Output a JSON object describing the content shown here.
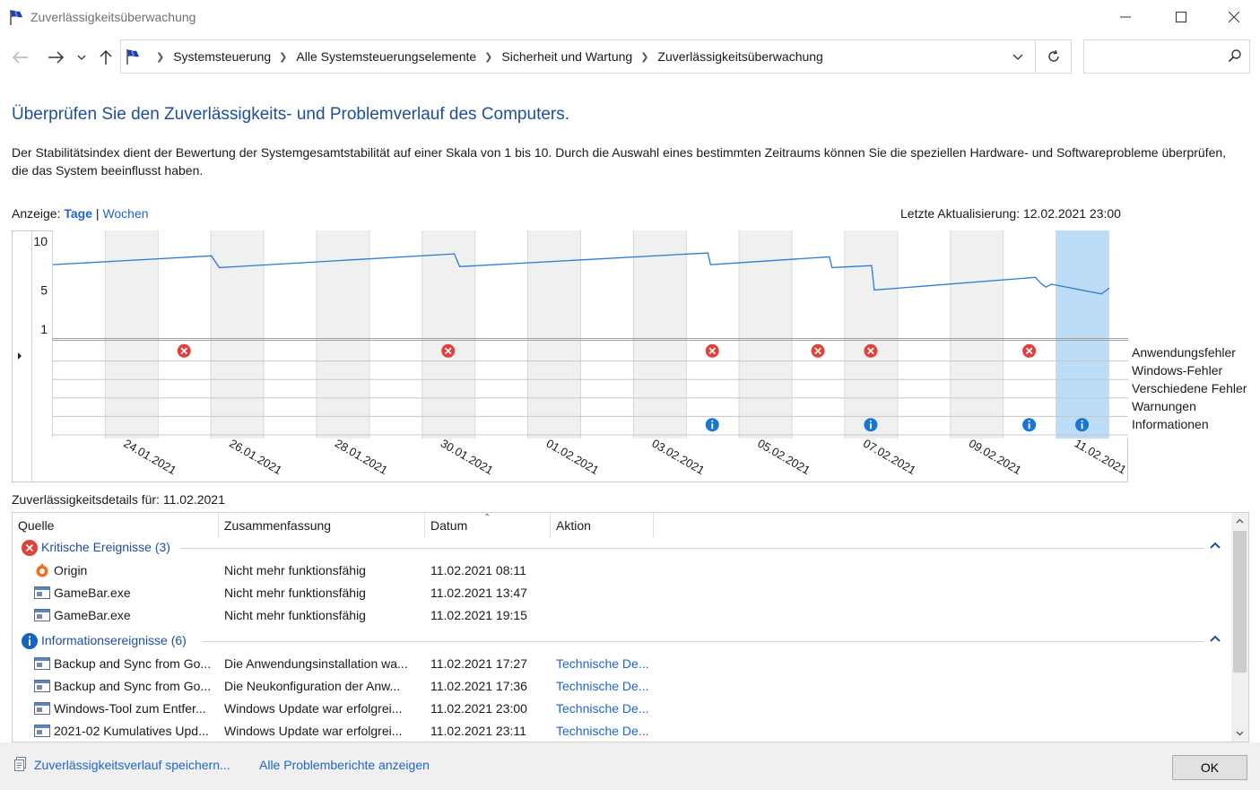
{
  "window": {
    "title": "Zuverlässigkeitsüberwachung"
  },
  "addressbar": {
    "crumbs": [
      "Systemsteuerung",
      "Alle Systemsteuerungselemente",
      "Sicherheit und Wartung",
      "Zuverlässigkeitsüberwachung"
    ],
    "search_placeholder": ""
  },
  "main": {
    "heading": "Überprüfen Sie den Zuverlässigkeits- und Problemverlauf des Computers.",
    "description": "Der Stabilitätsindex dient der Bewertung der Systemgesamtstabilität auf einer Skala von 1 bis 10. Durch die Auswahl eines bestimmten Zeitraums können Sie die speziellen Hardware- und Softwareprobleme überprüfen, die das System beeinflusst haben.",
    "view_label": "Anzeige:",
    "view_days": "Tage",
    "view_sep": "|",
    "view_weeks": "Wochen",
    "last_update": "Letzte Aktualisierung: 12.02.2021 23:00"
  },
  "chart_data": {
    "type": "line",
    "y_ticks": [
      "10",
      "5",
      "1"
    ],
    "ylim": [
      1,
      10
    ],
    "days": [
      "23.01.2021",
      "24.01.2021",
      "25.01.2021",
      "26.01.2021",
      "27.01.2021",
      "28.01.2021",
      "29.01.2021",
      "30.01.2021",
      "31.01.2021",
      "01.02.2021",
      "02.02.2021",
      "03.02.2021",
      "04.02.2021",
      "05.02.2021",
      "06.02.2021",
      "07.02.2021",
      "08.02.2021",
      "09.02.2021",
      "10.02.2021",
      "11.02.2021",
      "12.02.2021"
    ],
    "x_labels": [
      "24.01.2021",
      "26.01.2021",
      "28.01.2021",
      "30.01.2021",
      "01.02.2021",
      "03.02.2021",
      "05.02.2021",
      "07.02.2021",
      "09.02.2021",
      "11.02.2021"
    ],
    "selected_day": "11.02.2021",
    "stability_line": [
      [
        0,
        7.6
      ],
      [
        3,
        8.5
      ],
      [
        3.15,
        7.3
      ],
      [
        7.6,
        8.7
      ],
      [
        7.7,
        7.4
      ],
      [
        12.4,
        8.8
      ],
      [
        12.45,
        7.6
      ],
      [
        14.7,
        8.4
      ],
      [
        14.75,
        7.3
      ],
      [
        15.5,
        7.5
      ],
      [
        15.55,
        5.0
      ],
      [
        18.6,
        6.3
      ],
      [
        18.7,
        5.7
      ],
      [
        18.8,
        5.3
      ],
      [
        18.9,
        5.6
      ],
      [
        19.85,
        4.6
      ],
      [
        20,
        5.2
      ]
    ],
    "row_labels": [
      "Anwendungsfehler",
      "Windows-Fehler",
      "Verschiedene Fehler",
      "Warnungen",
      "Informationen"
    ],
    "events": [
      {
        "day": "25.01.2021",
        "row": "Anwendungsfehler",
        "kind": "error"
      },
      {
        "day": "30.01.2021",
        "row": "Anwendungsfehler",
        "kind": "error"
      },
      {
        "day": "04.02.2021",
        "row": "Anwendungsfehler",
        "kind": "error"
      },
      {
        "day": "06.02.2021",
        "row": "Anwendungsfehler",
        "kind": "error"
      },
      {
        "day": "07.02.2021",
        "row": "Anwendungsfehler",
        "kind": "error"
      },
      {
        "day": "10.02.2021",
        "row": "Anwendungsfehler",
        "kind": "error"
      },
      {
        "day": "04.02.2021",
        "row": "Informationen",
        "kind": "info"
      },
      {
        "day": "07.02.2021",
        "row": "Informationen",
        "kind": "info"
      },
      {
        "day": "10.02.2021",
        "row": "Informationen",
        "kind": "info"
      },
      {
        "day": "11.02.2021",
        "row": "Informationen",
        "kind": "info"
      }
    ],
    "colors": {
      "line": "#2b7bd6",
      "shade": "#f0f0f0",
      "selected": "#bcdcf7",
      "error": "#e0413a",
      "info": "#1976d2"
    }
  },
  "details": {
    "label": "Zuverlässigkeitsdetails für: 11.02.2021",
    "columns": [
      "Quelle",
      "Zusammenfassung",
      "Datum",
      "Aktion"
    ],
    "groups": [
      {
        "label": "Kritische Ereignisse (3)",
        "kind": "error",
        "rows": [
          {
            "icon": "origin-app-icon",
            "source": "Origin",
            "summary": "Nicht mehr funktionsfähig",
            "date": "11.02.2021 08:11",
            "action": ""
          },
          {
            "icon": "application-window-icon",
            "source": "GameBar.exe",
            "summary": "Nicht mehr funktionsfähig",
            "date": "11.02.2021 13:47",
            "action": ""
          },
          {
            "icon": "application-window-icon",
            "source": "GameBar.exe",
            "summary": "Nicht mehr funktionsfähig",
            "date": "11.02.2021 19:15",
            "action": ""
          }
        ]
      },
      {
        "label": "Informationsereignisse (6)",
        "kind": "info",
        "rows": [
          {
            "icon": "application-window-icon",
            "source": "Backup and Sync from Go...",
            "summary": "Die Anwendungsinstallation wa...",
            "date": "11.02.2021 17:27",
            "action": "Technische De..."
          },
          {
            "icon": "application-window-icon",
            "source": "Backup and Sync from Go...",
            "summary": "Die Neukonfiguration der Anw...",
            "date": "11.02.2021 17:36",
            "action": "Technische De..."
          },
          {
            "icon": "application-window-icon",
            "source": "Windows-Tool zum Entfer...",
            "summary": "Windows Update war erfolgrei...",
            "date": "11.02.2021 23:00",
            "action": "Technische De..."
          },
          {
            "icon": "application-window-icon",
            "source": "2021-02 Kumulatives Upd...",
            "summary": "Windows Update war erfolgrei...",
            "date": "11.02.2021 23:11",
            "action": "Technische De..."
          }
        ]
      }
    ]
  },
  "footer": {
    "save_link": "Zuverlässigkeitsverlauf speichern...",
    "reports_link": "Alle Problemberichte anzeigen",
    "ok_label": "OK"
  }
}
